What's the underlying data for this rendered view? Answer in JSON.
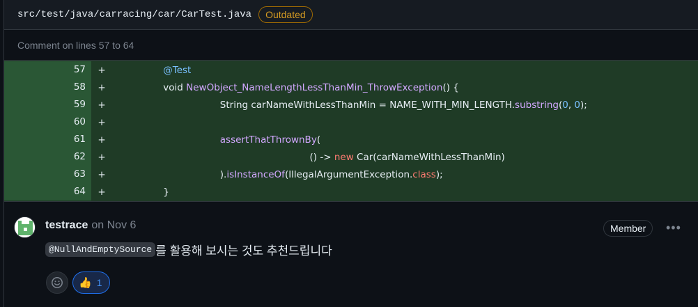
{
  "file": {
    "path": "src/test/java/carracing/car/CarTest.java",
    "status_badge": "Outdated"
  },
  "comment_range": "Comment on lines 57 to 64",
  "diff": {
    "marker": "+",
    "lines": [
      {
        "n": "57"
      },
      {
        "n": "58"
      },
      {
        "n": "59"
      },
      {
        "n": "60"
      },
      {
        "n": "61"
      },
      {
        "n": "62"
      },
      {
        "n": "63"
      },
      {
        "n": "64"
      }
    ],
    "code": {
      "l57_ann": "@Test",
      "l58_void": "void ",
      "l58_fn": "NewObject_NameLengthLessThanMin_ThrowException",
      "l58_tail": "() {",
      "l59_a": "String carNameWithLessThanMin = NAME_WITH_MIN_LENGTH.",
      "l59_fn": "substring",
      "l59_b": "(",
      "l59_n1": "0",
      "l59_c": ", ",
      "l59_n2": "0",
      "l59_d": ");",
      "l61_fn": "assertThatThrownBy",
      "l61_tail": "(",
      "l62_a": "() -> ",
      "l62_kw": "new",
      "l62_b": " Car(carNameWithLessThanMin)",
      "l63_a": ").",
      "l63_fn": "isInstanceOf",
      "l63_b": "(IllegalArgumentException.",
      "l63_kw": "class",
      "l63_c": ");",
      "l64": "}"
    }
  },
  "comment": {
    "author": "testrace",
    "date": "on Nov 6",
    "role_badge": "Member",
    "more_icon": "kebab-horizontal-icon",
    "inline_code": "@NullAndEmptySource",
    "text_after": "를 활용해 보시는 것도 추천드립니다",
    "reactions": [
      {
        "emoji": "thumbs-up",
        "count": "1"
      }
    ]
  },
  "colors": {
    "added_bg": "#1f3b26",
    "added_line_number_bg": "#2a5735",
    "outdated": "#d29922",
    "link_blue": "#4493f8"
  }
}
